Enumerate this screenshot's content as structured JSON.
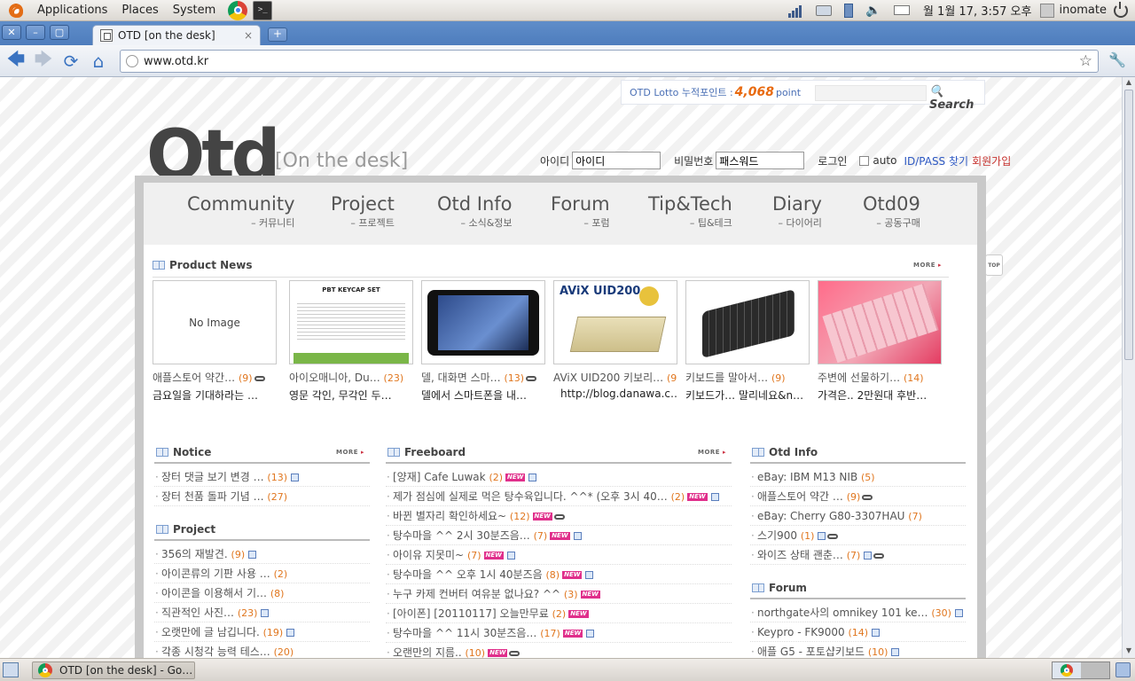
{
  "panel": {
    "menus": [
      "Applications",
      "Places",
      "System"
    ],
    "clock": "월  1월 17,  3:57 오후",
    "user": "inomate"
  },
  "browser": {
    "tab_title": "OTD [on the desk]",
    "url": "www.otd.kr",
    "close_glyph": "×",
    "new_tab_glyph": "+"
  },
  "site": {
    "lotto_label": "OTD Lotto 누적포인트 : ",
    "lotto_points": "4,068",
    "lotto_unit": " point",
    "search_label": "Search",
    "logo": "Otd",
    "logo_sub": "[On the desk]",
    "login": {
      "id_label": "아이디",
      "id_value": "아이디",
      "pw_label": "비밀번호",
      "pw_value": "패스워드",
      "login_label": "로그인",
      "auto_label": "auto",
      "find_label": "ID/PASS 찾기",
      "join_label": "회원가입"
    },
    "nav": [
      {
        "en": "Community",
        "ko": "– 커뮤니티"
      },
      {
        "en": "Project",
        "ko": "– 프로젝트"
      },
      {
        "en": "Otd Info",
        "ko": "– 소식&정보"
      },
      {
        "en": "Forum",
        "ko": "– 포럼"
      },
      {
        "en": "Tip&Tech",
        "ko": "– 팁&테크"
      },
      {
        "en": "Diary",
        "ko": "– 다이어리"
      },
      {
        "en": "Otd09",
        "ko": "– 공동구매"
      }
    ],
    "more_label": "MORE",
    "top_label": "TOP",
    "product_news": {
      "title": "Product News",
      "items": [
        {
          "thumb_text": "No Image",
          "name": "애플스토어 약간…",
          "count": "(9)",
          "desc": "금요일을 기대하라는 …"
        },
        {
          "thumb_text": "PBT KEYCAP SET",
          "name": "아이오매니아, Du…",
          "count": "(23)",
          "desc": "영문 각인, 무각인 두…"
        },
        {
          "thumb_text": "",
          "name": "델, 대화면 스마…",
          "count": "(13)",
          "desc": "델에서 스마트폰을 내…"
        },
        {
          "thumb_text": "AViX UID200",
          "name": "AViX UID200 키보리…",
          "count": "(9)",
          "desc": "http://blog.danawa.c…"
        },
        {
          "thumb_text": "",
          "name": "키보드를 말아서…",
          "count": "(9)",
          "desc": "키보드가… 말리네요&n…"
        },
        {
          "thumb_text": "",
          "name": "주변에 선물하기…",
          "count": "(14)",
          "desc": "가격은.. 2만원대 후반…"
        }
      ]
    },
    "notice": {
      "title": "Notice",
      "items": [
        {
          "text": "장터 댓글 보기 변경 …",
          "count": "(13)"
        },
        {
          "text": "장터 천품 돌파 기념 …",
          "count": "(27)"
        }
      ]
    },
    "project": {
      "title": "Project",
      "items": [
        {
          "text": "356의 재발견.",
          "count": "(9)"
        },
        {
          "text": "아이콘류의 기판 사용 …",
          "count": "(2)"
        },
        {
          "text": "아이콘을 이용해서 기…",
          "count": "(8)"
        },
        {
          "text": "직관적인 사진…",
          "count": "(23)"
        },
        {
          "text": "오랫만에 글 남깁니다.",
          "count": "(19)"
        },
        {
          "text": "각종 시청각 능력 테스…",
          "count": "(20)"
        }
      ]
    },
    "freeboard": {
      "title": "Freeboard",
      "items": [
        {
          "text": "[양재] Cafe Luwak",
          "count": "(2)"
        },
        {
          "text": "제가 점심에 실제로 먹은 탕수육입니다. ^^* (오후 3시 40…",
          "count": "(2)"
        },
        {
          "text": "바뀐 별자리 확인하세요~",
          "count": "(12)"
        },
        {
          "text": "탕수마을 ^^ 2시 30분즈음…",
          "count": "(7)"
        },
        {
          "text": "아이유 지못미~",
          "count": "(7)"
        },
        {
          "text": "탕수마을 ^^ 오후 1시 40분즈음",
          "count": "(8)"
        },
        {
          "text": "누구 카제 컨버터 여유분 없나요? ^^",
          "count": "(3)"
        },
        {
          "text": "[아이폰] [20110117] 오늘만무료",
          "count": "(2)"
        },
        {
          "text": "탕수마을 ^^ 11시 30분즈음…",
          "count": "(17)"
        },
        {
          "text": "오랜만의 지름..",
          "count": "(10)"
        }
      ]
    },
    "otdinfo": {
      "title": "Otd Info",
      "items": [
        {
          "text": "eBay: IBM M13 NIB",
          "count": "(5)"
        },
        {
          "text": "애플스토어 약간 …",
          "count": "(9)"
        },
        {
          "text": "eBay: Cherry G80-3307HAU",
          "count": "(7)"
        },
        {
          "text": "스기900",
          "count": "(1)"
        },
        {
          "text": "와이즈 상태 괜춘…",
          "count": "(7)"
        }
      ]
    },
    "forum": {
      "title": "Forum",
      "items": [
        {
          "text": "northgate사의 omnikey 101 ke…",
          "count": "(30)"
        },
        {
          "text": "Keypro - FK9000",
          "count": "(14)"
        },
        {
          "text": "애플 G5 - 포토샵키보드",
          "count": "(10)"
        }
      ]
    }
  },
  "taskbar": {
    "window_title": "OTD [on the desk] - Go…"
  }
}
